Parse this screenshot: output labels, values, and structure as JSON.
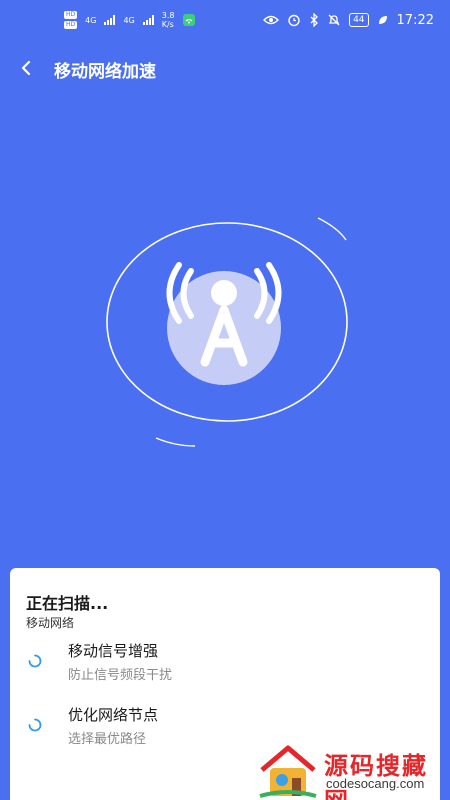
{
  "status_bar": {
    "hd1": "HD",
    "hd2": "HD",
    "net1": "4G",
    "net2": "4G",
    "speed_value": "3.8",
    "speed_unit": "K/s",
    "battery": "44",
    "time": "17:22"
  },
  "header": {
    "back_icon": "chevron-left-icon",
    "title": "移动网络加速"
  },
  "radar": {
    "icon": "signal-tower-icon",
    "ring_color": "#ffffff",
    "circle_fill": "#c5cdf7"
  },
  "card": {
    "scan_title": "正在扫描...",
    "scan_sub": "移动网络",
    "items": [
      {
        "title": "移动信号增强",
        "desc": "防止信号频段干扰",
        "icon": "loading-spinner-icon"
      },
      {
        "title": "优化网络节点",
        "desc": "选择最优路径",
        "icon": "loading-spinner-icon"
      }
    ],
    "spinner_color": "#2f9bf2"
  },
  "watermark": {
    "text": "源码搜藏网",
    "url": "codesocang.com"
  },
  "colors": {
    "background": "#4a6ff0",
    "card": "#ffffff",
    "watermark_red": "#e5262a"
  }
}
